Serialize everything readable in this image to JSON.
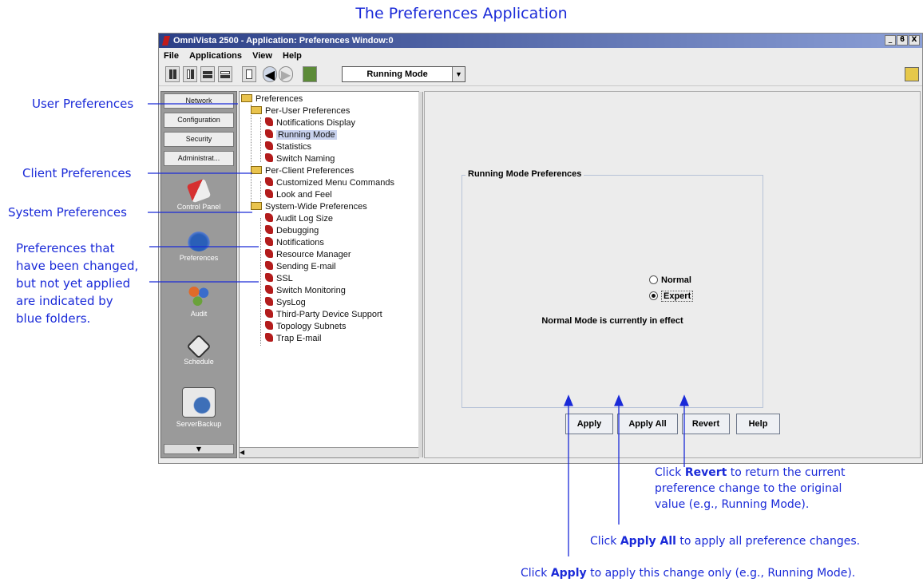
{
  "page": {
    "title": "The Preferences Application"
  },
  "window": {
    "title": "OmniVista 2500 -  Application: Preferences  Window:0",
    "controls": [
      "_",
      "ϐ",
      "X"
    ],
    "menus": [
      "File",
      "Applications",
      "View",
      "Help"
    ],
    "toolbar": {
      "mode_select": "Running Mode"
    }
  },
  "launcher": {
    "buttons": [
      "Network",
      "Configuration",
      "Security",
      "Administrat..."
    ],
    "items": [
      "Control Panel",
      "Preferences",
      "Audit",
      "Schedule",
      "ServerBackup"
    ]
  },
  "tree": {
    "root": "Preferences",
    "groups": [
      {
        "label": "Per-User Preferences",
        "children": [
          "Notifications Display",
          "Running Mode",
          "Statistics",
          "Switch Naming"
        ]
      },
      {
        "label": "Per-Client Preferences",
        "children": [
          "Customized Menu Commands",
          "Look and Feel"
        ]
      },
      {
        "label": "System-Wide Preferences",
        "children": [
          "Audit Log Size",
          "Debugging",
          "Notifications",
          "Resource Manager",
          "Sending E-mail",
          "SSL",
          "Switch Monitoring",
          "SysLog",
          "Third-Party Device Support",
          "Topology Subnets",
          "Trap E-mail"
        ]
      }
    ],
    "selected": "Running Mode"
  },
  "content": {
    "group_title": "Running Mode Preferences",
    "radios": [
      {
        "label": "Normal",
        "checked": false
      },
      {
        "label": "Expert",
        "checked": true
      }
    ],
    "status": "Normal Mode is currently in effect",
    "buttons": [
      "Apply",
      "Apply All",
      "Revert",
      "Help"
    ]
  },
  "annotations": {
    "user": "User Preferences",
    "client": "Client Preferences",
    "system": "System Preferences",
    "changed": [
      "Preferences that",
      "have been changed,",
      "but not yet applied",
      "are indicated by",
      "blue folders."
    ],
    "revert": {
      "pre": "Click ",
      "bold": "Revert",
      "post": " to return the current",
      "line2": "preference change to the original",
      "line3": "value (e.g., Running Mode)."
    },
    "apply_all": {
      "pre": "Click ",
      "bold": "Apply All",
      "post": " to apply all preference changes."
    },
    "apply": {
      "pre": "Click ",
      "bold": "Apply",
      "post": " to apply this change only (e.g., Running Mode)."
    }
  }
}
